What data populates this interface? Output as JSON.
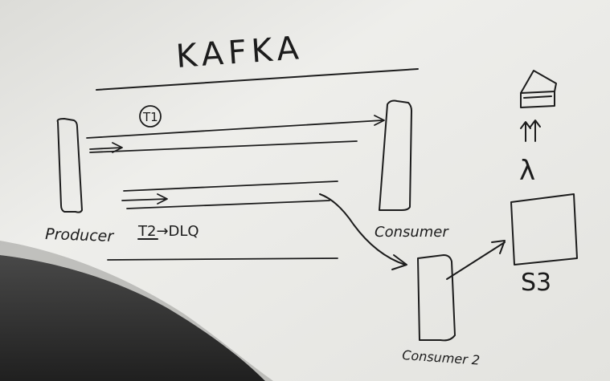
{
  "diagram": {
    "title": "KAFKA",
    "topic1": "T1",
    "producer_label": "Producer",
    "consumer_label": "Consumer",
    "topic2_label": "T2→DLQ",
    "consumer2_label": "Consumer 2",
    "s3_label": "S3",
    "lambda_label": "λ"
  }
}
